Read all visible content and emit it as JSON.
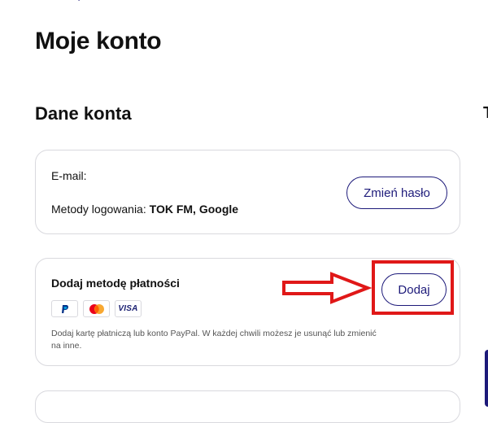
{
  "page": {
    "title": "Moje konto",
    "right_edge_glyph": "T"
  },
  "account_section": {
    "title": "Dane konta",
    "email_label": "E-mail:",
    "login_methods_label": "Metody logowania:",
    "login_methods_value": "TOK FM, Google",
    "change_password_button": "Zmień hasło"
  },
  "payment_card": {
    "title": "Dodaj metodę płatności",
    "add_button": "Dodaj",
    "icons": [
      "paypal-icon",
      "mastercard-icon",
      "visa-icon"
    ],
    "visa_label": "VISA",
    "description": "Dodaj kartę płatniczą lub konto PayPal. W każdej chwili możesz je usunąć lub zmienić na inne."
  },
  "colors": {
    "accent": "#1d1a7a",
    "annotation": "#e01818",
    "border": "#d9d9de"
  }
}
